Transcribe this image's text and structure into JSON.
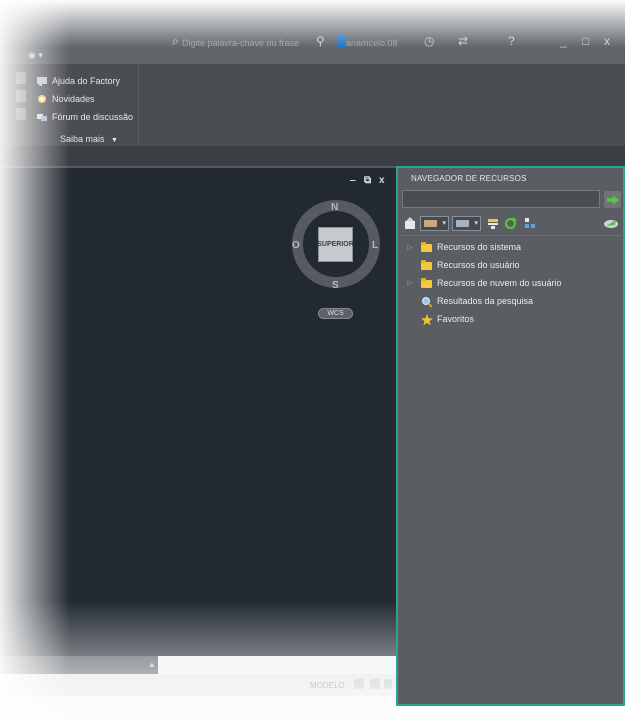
{
  "title_bar": {
    "search_placeholder": "Digite palavra-chave ou frase",
    "user_label": "anamcelo.08",
    "help_glyph": "?",
    "window_controls": [
      "_",
      "□",
      "x"
    ]
  },
  "ribbon": {
    "help_items": [
      {
        "label": "Ajuda do Factory",
        "icon": "help-book-icon"
      },
      {
        "label": "Novidades",
        "icon": "star-burst-icon"
      },
      {
        "label": "Fórum de discussão",
        "icon": "forum-icon"
      }
    ],
    "saiba_mais_label": "Saiba mais",
    "saiba_mais_arrow": "▼"
  },
  "viewport": {
    "controls": {
      "minimize": "‒",
      "restore": "⧉",
      "close": "x"
    },
    "viewcube": {
      "face_label": "SUPERIOR",
      "north": "N",
      "south": "S",
      "west": "O",
      "east": "L",
      "wcs_label": "WCS"
    }
  },
  "status_bar": {
    "model_label": "MODELO"
  },
  "resource_navigator": {
    "title": "NAVEGADOR DE RECURSOS",
    "search": {
      "value": "",
      "placeholder": ""
    },
    "toolbar_icons": [
      "import-icon",
      "view-mode-dropdown-icon",
      "group-mode-dropdown-icon",
      "filter-icon",
      "refresh-icon",
      "settings-icon",
      "cloud-icon"
    ],
    "tree": [
      {
        "label": "Recursos do sistema",
        "icon": "folder-icon",
        "expandable": true
      },
      {
        "label": "Recursos do usuário",
        "icon": "folder-icon",
        "expandable": false
      },
      {
        "label": "Recursos de nuvem do usuário",
        "icon": "folder-icon",
        "expandable": true
      },
      {
        "label": "Resultados da pesquisa",
        "icon": "search-results-icon",
        "expandable": false
      },
      {
        "label": "Favoritos",
        "icon": "star-icon",
        "expandable": false
      }
    ]
  },
  "colors": {
    "panel_border": "#27a88e",
    "viewport_bg": "#222931",
    "panel_bg": "#5a5d61",
    "folder": "#f6c93c"
  }
}
